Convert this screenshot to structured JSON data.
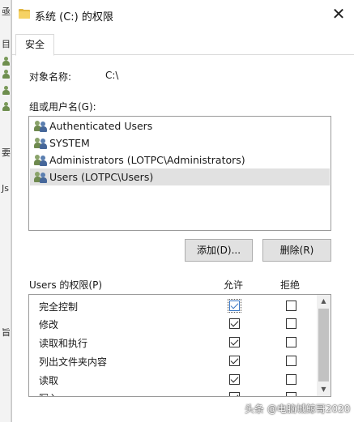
{
  "background_window": {
    "glyphs": [
      "亟",
      "目",
      "要",
      "Js",
      "旨"
    ]
  },
  "dialog": {
    "title": "系统 (C:) 的权限",
    "tab": "安全",
    "object_name_label": "对象名称:",
    "object_name_value": "C:\\",
    "groups_label": "组或用户名(G):",
    "groups": [
      {
        "label": "Authenticated Users",
        "selected": false
      },
      {
        "label": "SYSTEM",
        "selected": false
      },
      {
        "label": "Administrators (LOTPC\\Administrators)",
        "selected": false
      },
      {
        "label": "Users (LOTPC\\Users)",
        "selected": true
      }
    ],
    "add_button": "添加(D)...",
    "remove_button": "删除(R)",
    "permissions_label": "Users 的权限(P)",
    "allow_header": "允许",
    "deny_header": "拒绝",
    "permissions": [
      {
        "name": "完全控制",
        "allow": true,
        "deny": false
      },
      {
        "name": "修改",
        "allow": true,
        "deny": false
      },
      {
        "name": "读取和执行",
        "allow": true,
        "deny": false
      },
      {
        "name": "列出文件夹内容",
        "allow": true,
        "deny": false
      },
      {
        "name": "读取",
        "allow": true,
        "deny": false
      },
      {
        "name": "写入",
        "allow": true,
        "deny": false
      }
    ]
  },
  "watermark": "头条 @电脑城鲸哥2020",
  "colors": {
    "selected_row": "#e1e1e1",
    "focus": "#3b77c4",
    "folder": "#f6d264"
  }
}
